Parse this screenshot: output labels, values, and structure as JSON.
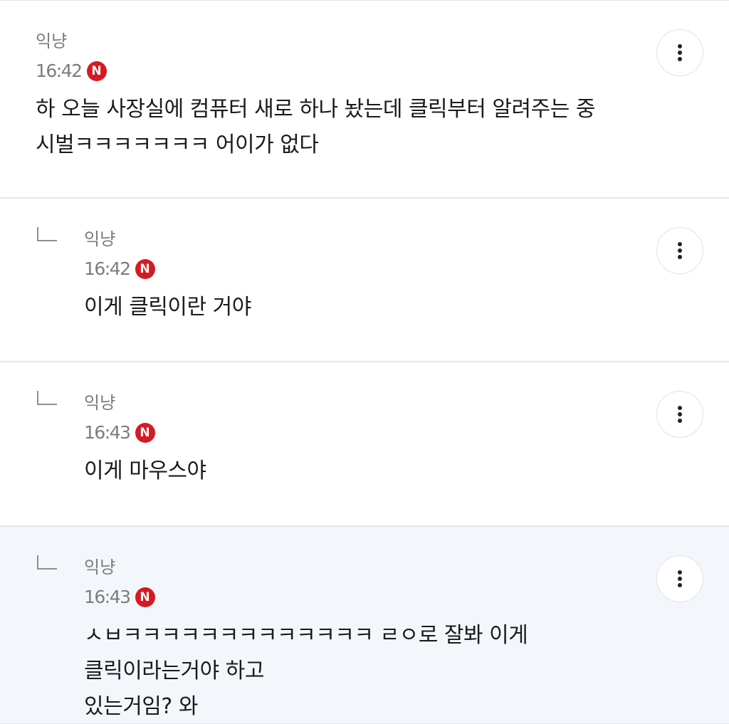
{
  "comments": [
    {
      "author": "익냥",
      "time": "16:42",
      "badge": "N",
      "text_line1": "하 오늘 사장실에 컴퓨터 새로 하나 놨는데 클릭부터 알려주는 중",
      "text_line2": "시벌ㅋㅋㅋㅋㅋㅋㅋ 어이가 없다"
    },
    {
      "author": "익냥",
      "time": "16:42",
      "badge": "N",
      "text_line1": "이게 클릭이란 거야"
    },
    {
      "author": "익냥",
      "time": "16:43",
      "badge": "N",
      "text_line1": "이게 마우스야"
    },
    {
      "author": "익냥",
      "time": "16:43",
      "badge": "N",
      "text_line1": "ㅅㅂㅋㅋㅋㅋㅋㅋㅋㅋㅋㅋㅋㅋㅋ ㄹㅇ로 잘봐 이게 클릭이라는거야 하고",
      "text_line2": "있는거임? 와"
    }
  ],
  "icons": {
    "more": "more-vertical-icon",
    "reply": "reply-arrow-icon"
  },
  "colors": {
    "badge": "#d61a22",
    "highlight_bg": "#f3f7fb",
    "meta_text": "#7d7d7d",
    "body_text": "#1b1b1b"
  }
}
